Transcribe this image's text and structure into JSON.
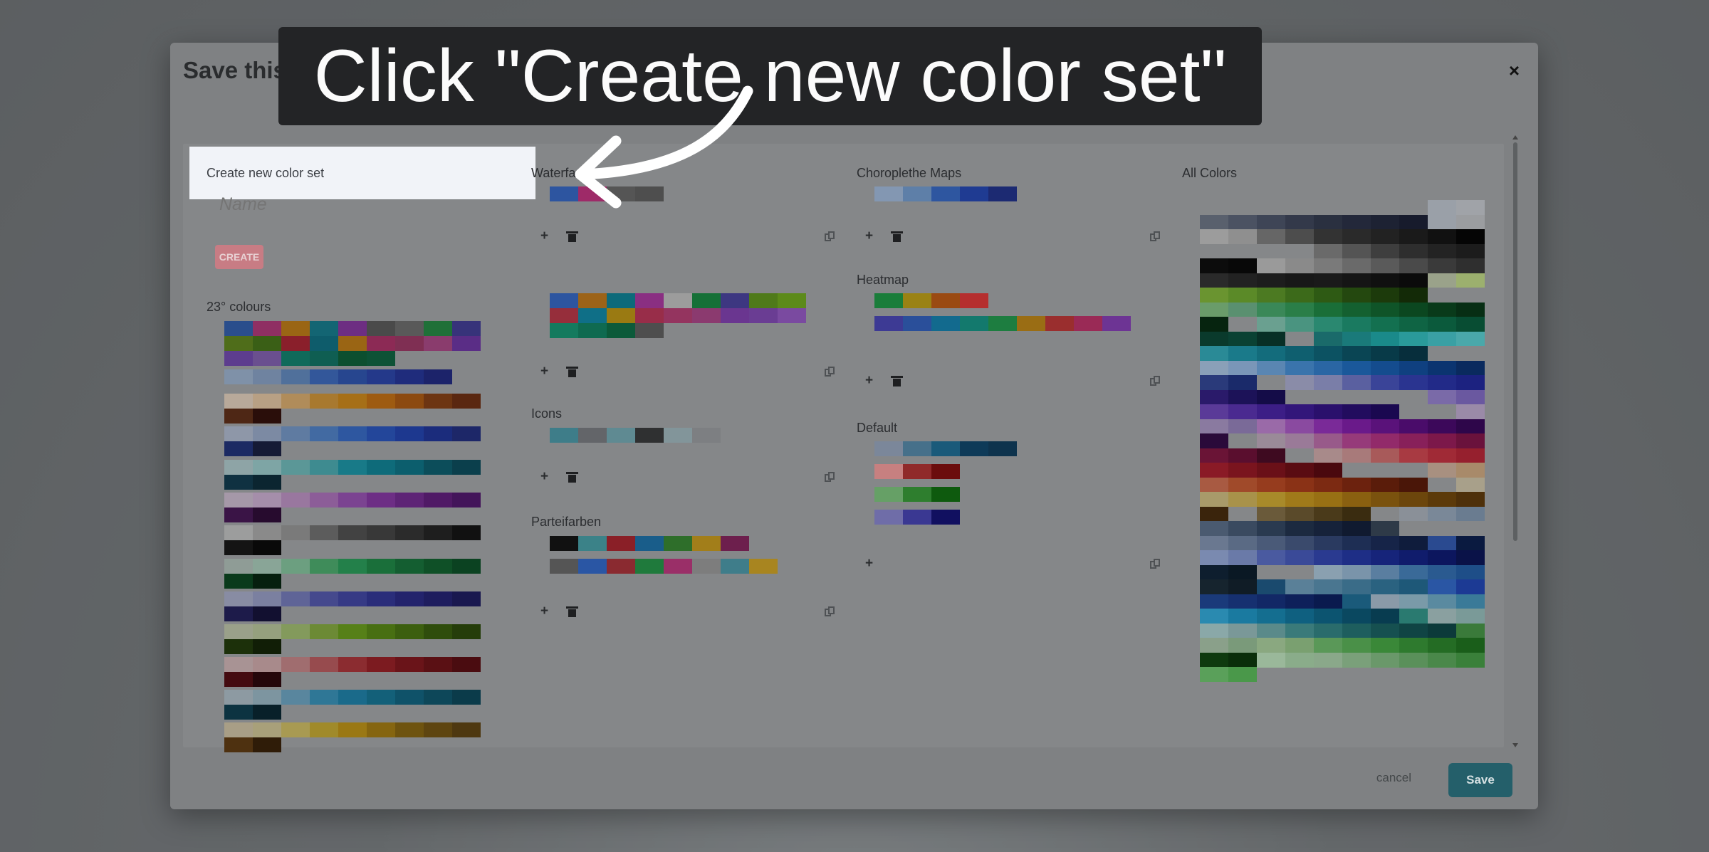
{
  "modal": {
    "title": "Save this color",
    "close_symbol": "×",
    "cancel_label": "cancel",
    "save_label": "Save"
  },
  "tutorial": {
    "banner_text": "Click \"Create new color set\""
  },
  "create_panel": {
    "new_set_label": "Create new color set",
    "name_placeholder": "Name",
    "create_label": "CREATE"
  },
  "color_sets": {
    "c23": {
      "title": "23° colours"
    },
    "waterfall": {
      "title": "Waterfa"
    },
    "icons": {
      "title": "Icons"
    },
    "parteifarben": {
      "title": "Parteifarben"
    },
    "choropleth": {
      "title": "Choroplethe Maps"
    },
    "heatmap": {
      "title": "Heatmap"
    },
    "default": {
      "title": "Default"
    },
    "all": {
      "title": "All Colors"
    }
  },
  "icons": {
    "add": "+",
    "trash": "trash-icon",
    "copy": "copy-icon",
    "close": "close-icon"
  },
  "colors": {
    "save_button": "#245f6a",
    "create_button": "#c87c84",
    "banner": "#232426"
  }
}
